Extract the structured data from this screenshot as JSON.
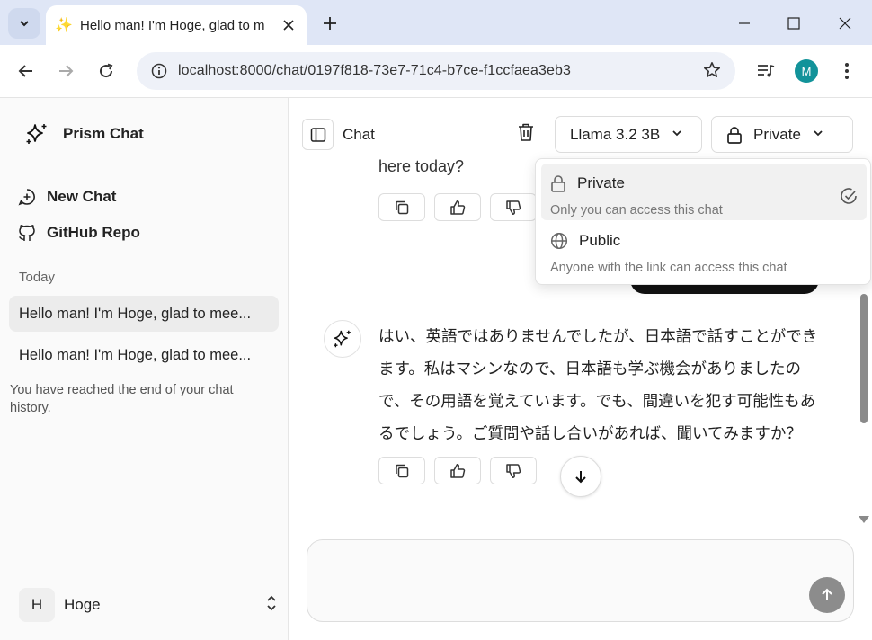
{
  "browser": {
    "tab_title": "Hello man! I'm Hoge, glad to m",
    "url": "localhost:8000/chat/0197f818-73e7-71c4-b7ce-f1ccfaea3eb3",
    "profile_initial": "M"
  },
  "sidebar": {
    "brand": "Prism Chat",
    "new_chat": "New Chat",
    "github": "GitHub Repo",
    "section": "Today",
    "chats": [
      "Hello man! I'm Hoge, glad to mee...",
      "Hello man! I'm Hoge, glad to mee..."
    ],
    "end_note": "You have reached the end of your chat history.",
    "user": {
      "initial": "H",
      "name": "Hoge"
    }
  },
  "header": {
    "title": "Chat",
    "model": "Llama 3.2 3B",
    "visibility": "Private"
  },
  "messages": {
    "prev_fragment": "here today?",
    "assistant_text": "はい、英語ではありませんでしたが、日本語で話すことができます。私はマシンなので、日本語も学ぶ機会がありましたので、その用語を覚えています。でも、間違いを犯す可能性もあるでしょう。ご質問や話し合いがあれば、聞いてみますか？"
  },
  "visibility_menu": {
    "options": [
      {
        "label": "Private",
        "desc": "Only you can access this chat",
        "selected": true
      },
      {
        "label": "Public",
        "desc": "Anyone with the link can access this chat",
        "selected": false
      }
    ]
  },
  "colors": {
    "send_button": "#8c8c8c",
    "avatar_m": "#12939a",
    "user_bubble": "#111111"
  }
}
